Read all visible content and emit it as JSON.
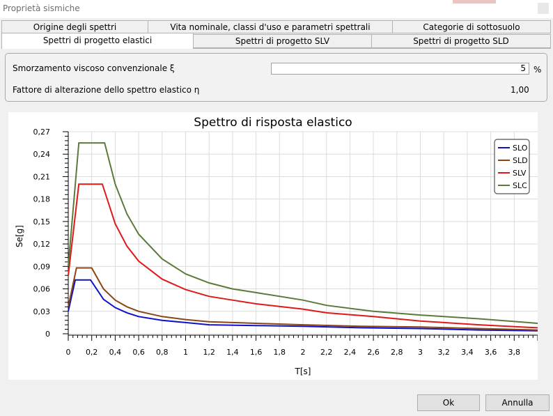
{
  "window": {
    "title": "Proprietà sismiche"
  },
  "tabs_row1": [
    {
      "label": "Origine degli spettri"
    },
    {
      "label": "Vita nominale, classi d'uso e parametri spettrali"
    },
    {
      "label": "Categorie di sottosuolo"
    }
  ],
  "tabs_row2": [
    {
      "label": "Spettri di progetto elastici",
      "active": true
    },
    {
      "label": "Spettri di progetto SLV"
    },
    {
      "label": "Spettri di progetto SLD"
    }
  ],
  "params": {
    "damping_label": "Smorzamento viscoso convenzionale ξ",
    "damping_value": "5",
    "damping_unit": "%",
    "eta_label": "Fattore di alterazione dello spettro elastico η",
    "eta_value": "1,00"
  },
  "chart_data": {
    "type": "line",
    "title": "Spettro di risposta elastico",
    "xlabel": "T[s]",
    "ylabel": "Se[g]",
    "xlim": [
      0,
      4.0
    ],
    "ylim": [
      0,
      0.27
    ],
    "xticks": [
      "0",
      "0,2",
      "0,4",
      "0,6",
      "0,8",
      "1",
      "1,2",
      "1,4",
      "1,6",
      "1,8",
      "2",
      "2,2",
      "2,4",
      "2,6",
      "2,8",
      "3",
      "3,2",
      "3,4",
      "3,6",
      "3,8"
    ],
    "yticks": [
      "0",
      "0,03",
      "0,06",
      "0,09",
      "0,12",
      "0,15",
      "0,18",
      "0,21",
      "0,24",
      "0,27"
    ],
    "grid": true,
    "legend_position": "top-right",
    "series": [
      {
        "name": "SLO",
        "color": "#1010c8",
        "x": [
          0,
          0.06,
          0.19,
          0.3,
          0.4,
          0.5,
          0.6,
          0.8,
          1.0,
          1.2,
          1.6,
          2.0,
          2.5,
          3.0,
          3.5,
          4.0
        ],
        "y": [
          0.03,
          0.072,
          0.072,
          0.046,
          0.035,
          0.028,
          0.023,
          0.018,
          0.015,
          0.012,
          0.011,
          0.01,
          0.008,
          0.007,
          0.005,
          0.004
        ]
      },
      {
        "name": "SLD",
        "color": "#8b4513",
        "x": [
          0,
          0.07,
          0.2,
          0.3,
          0.4,
          0.5,
          0.6,
          0.8,
          1.0,
          1.2,
          1.6,
          2.0,
          2.5,
          3.0,
          3.5,
          4.0
        ],
        "y": [
          0.036,
          0.088,
          0.088,
          0.06,
          0.045,
          0.036,
          0.03,
          0.023,
          0.019,
          0.016,
          0.014,
          0.012,
          0.01,
          0.009,
          0.007,
          0.005
        ]
      },
      {
        "name": "SLV",
        "color": "#e01818",
        "x": [
          0,
          0.09,
          0.29,
          0.4,
          0.5,
          0.6,
          0.8,
          1.0,
          1.2,
          1.4,
          1.6,
          2.0,
          2.2,
          2.6,
          3.0,
          3.5,
          4.0
        ],
        "y": [
          0.078,
          0.2,
          0.2,
          0.147,
          0.117,
          0.097,
          0.073,
          0.059,
          0.05,
          0.045,
          0.04,
          0.033,
          0.028,
          0.023,
          0.017,
          0.012,
          0.008
        ]
      },
      {
        "name": "SLC",
        "color": "#5a7a3a",
        "x": [
          0,
          0.09,
          0.31,
          0.4,
          0.5,
          0.6,
          0.8,
          1.0,
          1.2,
          1.4,
          1.6,
          2.0,
          2.2,
          2.6,
          3.0,
          3.5,
          4.0
        ],
        "y": [
          0.09,
          0.255,
          0.255,
          0.2,
          0.16,
          0.133,
          0.1,
          0.08,
          0.068,
          0.06,
          0.055,
          0.045,
          0.038,
          0.03,
          0.025,
          0.02,
          0.014
        ]
      }
    ]
  },
  "buttons": {
    "ok": "Ok",
    "cancel": "Annulla"
  }
}
